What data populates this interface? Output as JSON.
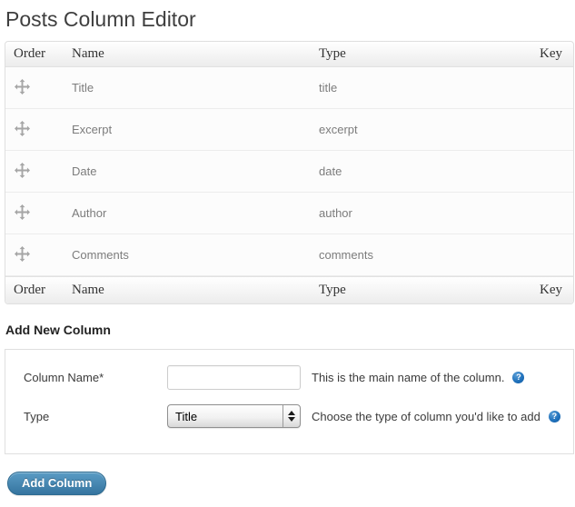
{
  "page": {
    "title": "Posts Column Editor"
  },
  "table": {
    "headers": {
      "order": "Order",
      "name": "Name",
      "type": "Type",
      "key": "Key"
    },
    "rows": [
      {
        "name": "Title",
        "type": "title",
        "key": ""
      },
      {
        "name": "Excerpt",
        "type": "excerpt",
        "key": ""
      },
      {
        "name": "Date",
        "type": "date",
        "key": ""
      },
      {
        "name": "Author",
        "type": "author",
        "key": ""
      },
      {
        "name": "Comments",
        "type": "comments",
        "key": ""
      }
    ]
  },
  "add_new": {
    "heading": "Add New Column",
    "column_name": {
      "label": "Column Name*",
      "value": "",
      "help": "This is the main name of the column."
    },
    "type": {
      "label": "Type",
      "selected": "Title",
      "help": "Choose the type of column you'd like to add"
    },
    "help_icon_glyph": "?",
    "submit_label": "Add Column"
  },
  "colors": {
    "primary_button_blue": "#3e80ab",
    "help_icon_blue": "#1d6fba",
    "header_text": "#333333",
    "row_text": "#7c7c7c"
  }
}
